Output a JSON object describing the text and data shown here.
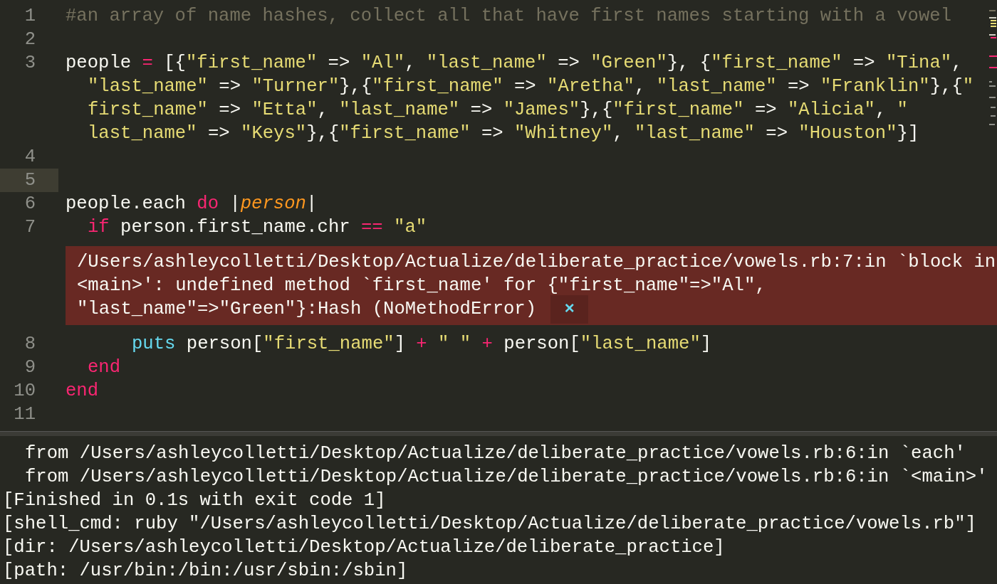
{
  "editor": {
    "lines": [
      {
        "number": "1",
        "current": false,
        "wrapped_lines": [
          {
            "tokens": [
              {
                "kind": "comment",
                "text": "#an array of name hashes, collect all that have first names starting with a vowel"
              }
            ]
          }
        ]
      },
      {
        "number": "2",
        "current": false
      },
      {
        "number": "3",
        "current": false,
        "wrapped_lines": [
          {
            "tokens": [
              {
                "kind": "plain",
                "text": "people "
              },
              {
                "kind": "operator",
                "text": "="
              },
              {
                "kind": "plain",
                "text": " [{"
              },
              {
                "kind": "string",
                "text": "\"first_name\""
              },
              {
                "kind": "plain",
                "text": " => "
              },
              {
                "kind": "string",
                "text": "\"Al\""
              },
              {
                "kind": "plain",
                "text": ", "
              },
              {
                "kind": "string",
                "text": "\"last_name\""
              },
              {
                "kind": "plain",
                "text": " => "
              },
              {
                "kind": "string",
                "text": "\"Green\""
              },
              {
                "kind": "plain",
                "text": "}, {"
              },
              {
                "kind": "string",
                "text": "\"first_name\""
              },
              {
                "kind": "plain",
                "text": " => "
              },
              {
                "kind": "string",
                "text": "\"Tina\""
              },
              {
                "kind": "plain",
                "text": ","
              }
            ]
          },
          {
            "tokens": [
              {
                "kind": "string",
                "text": "\"last_name\""
              },
              {
                "kind": "plain",
                "text": " => "
              },
              {
                "kind": "string",
                "text": "\"Turner\""
              },
              {
                "kind": "plain",
                "text": "},{"
              },
              {
                "kind": "string",
                "text": "\"first_name\""
              },
              {
                "kind": "plain",
                "text": " => "
              },
              {
                "kind": "string",
                "text": "\"Aretha\""
              },
              {
                "kind": "plain",
                "text": ", "
              },
              {
                "kind": "string",
                "text": "\"last_name\""
              },
              {
                "kind": "plain",
                "text": " => "
              },
              {
                "kind": "string",
                "text": "\"Franklin\""
              },
              {
                "kind": "plain",
                "text": "},{"
              },
              {
                "kind": "string",
                "text": "\""
              }
            ]
          },
          {
            "tokens": [
              {
                "kind": "string",
                "text": "first_name\""
              },
              {
                "kind": "plain",
                "text": " => "
              },
              {
                "kind": "string",
                "text": "\"Etta\""
              },
              {
                "kind": "plain",
                "text": ", "
              },
              {
                "kind": "string",
                "text": "\"last_name\""
              },
              {
                "kind": "plain",
                "text": " => "
              },
              {
                "kind": "string",
                "text": "\"James\""
              },
              {
                "kind": "plain",
                "text": "},{"
              },
              {
                "kind": "string",
                "text": "\"first_name\""
              },
              {
                "kind": "plain",
                "text": " => "
              },
              {
                "kind": "string",
                "text": "\"Alicia\""
              },
              {
                "kind": "plain",
                "text": ", "
              },
              {
                "kind": "string",
                "text": "\""
              }
            ]
          },
          {
            "tokens": [
              {
                "kind": "string",
                "text": "last_name\""
              },
              {
                "kind": "plain",
                "text": " => "
              },
              {
                "kind": "string",
                "text": "\"Keys\""
              },
              {
                "kind": "plain",
                "text": "},{"
              },
              {
                "kind": "string",
                "text": "\"first_name\""
              },
              {
                "kind": "plain",
                "text": " => "
              },
              {
                "kind": "string",
                "text": "\"Whitney\""
              },
              {
                "kind": "plain",
                "text": ", "
              },
              {
                "kind": "string",
                "text": "\"last_name\""
              },
              {
                "kind": "plain",
                "text": " => "
              },
              {
                "kind": "string",
                "text": "\"Houston\""
              },
              {
                "kind": "plain",
                "text": "}]"
              }
            ]
          }
        ]
      },
      {
        "number": "4",
        "current": false
      },
      {
        "number": "5",
        "current": true
      },
      {
        "number": "6",
        "current": false,
        "wrapped_lines": [
          {
            "tokens": [
              {
                "kind": "plain",
                "text": "people.each "
              },
              {
                "kind": "keyword",
                "text": "do"
              },
              {
                "kind": "plain",
                "text": " |"
              },
              {
                "kind": "param",
                "text": "person"
              },
              {
                "kind": "plain",
                "text": "|"
              }
            ]
          }
        ],
        "children": [
          {
            "number": "7",
            "current": false,
            "wrapped_lines": [
              {
                "tokens": [
                  {
                    "kind": "keyword",
                    "text": "if"
                  },
                  {
                    "kind": "plain",
                    "text": " person.first_name.chr "
                  },
                  {
                    "kind": "operator",
                    "text": "=="
                  },
                  {
                    "kind": "string",
                    "text": "\"a\"",
                    "space_before": true
                  }
                ]
              }
            ],
            "error": {
              "lines": [
                "/Users/ashleycolletti/Desktop/Actualize/deliberate_practice/vowels.rb:7:in `block in",
                "<main>': undefined method `first_name' for {\"first_name\"=>\"Al\",",
                "\"last_name\"=>\"Green\"}:Hash (NoMethodError)"
              ],
              "close": "×"
            },
            "children": [
              {
                "number": "8",
                "current": false,
                "wrapped_lines": [
                  {
                    "tokens": [
                      {
                        "kind": "builtin",
                        "text": "puts"
                      },
                      {
                        "kind": "plain",
                        "text": " person["
                      },
                      {
                        "kind": "string",
                        "text": "\"first_name\""
                      },
                      {
                        "kind": "plain",
                        "text": "] "
                      },
                      {
                        "kind": "operator",
                        "text": "+"
                      },
                      {
                        "kind": "string",
                        "text": "\" \"",
                        "space_before": true
                      },
                      {
                        "kind": "operator",
                        "text": "+",
                        "space_before": true
                      },
                      {
                        "kind": "plain",
                        "text": " person["
                      },
                      {
                        "kind": "string",
                        "text": "\"last_name\""
                      },
                      {
                        "kind": "plain",
                        "text": "]"
                      }
                    ]
                  }
                ]
              }
            ]
          },
          {
            "number": "9",
            "current": false,
            "wrapped_lines": [
              {
                "tokens": [
                  {
                    "kind": "keyword",
                    "text": "end"
                  }
                ]
              }
            ]
          }
        ]
      },
      {
        "number": "10",
        "current": false,
        "wrapped_lines": [
          {
            "tokens": [
              {
                "kind": "keyword",
                "text": "end"
              }
            ]
          }
        ]
      },
      {
        "number": "11",
        "current": false
      }
    ]
  },
  "output": {
    "lines": [
      {
        "kind": "trace",
        "text": "from /Users/ashleycolletti/Desktop/Actualize/deliberate_practice/vowels.rb:6:in `each'"
      },
      {
        "kind": "trace",
        "text": "from /Users/ashleycolletti/Desktop/Actualize/deliberate_practice/vowels.rb:6:in `<main>'"
      },
      {
        "kind": "info",
        "text": "[Finished in 0.1s with exit code 1]"
      },
      {
        "kind": "info",
        "text": "[shell_cmd: ruby \"/Users/ashleycolletti/Desktop/Actualize/deliberate_practice/vowels.rb\"]"
      },
      {
        "kind": "info",
        "text": "[dir: /Users/ashleycolletti/Desktop/Actualize/deliberate_practice]"
      },
      {
        "kind": "info",
        "text": "[path: /usr/bin:/bin:/usr/sbin:/sbin]"
      }
    ]
  }
}
